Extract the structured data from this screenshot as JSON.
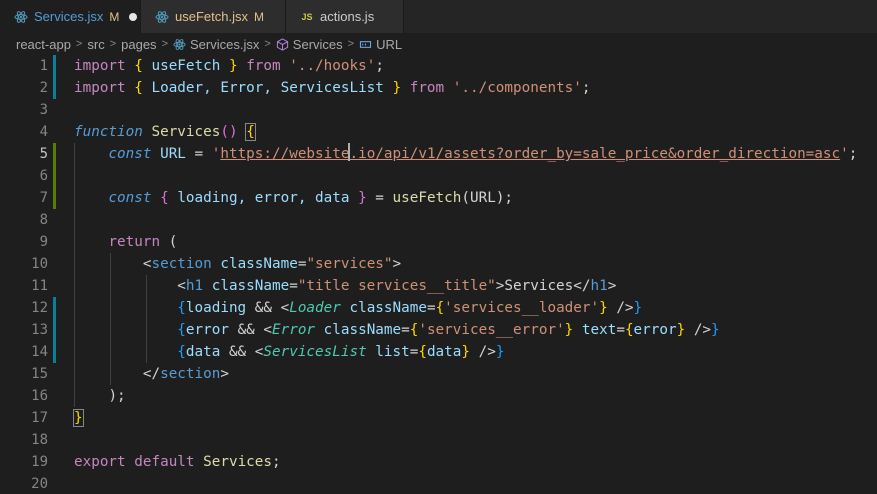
{
  "tabs": [
    {
      "name": "Services.jsx",
      "status": "M",
      "modified_dot": true,
      "icon": "react-icon",
      "active": true,
      "name_color": "#569cd6",
      "status_color": "#e2c08d"
    },
    {
      "name": "useFetch.jsx",
      "status": "M",
      "modified_dot": false,
      "icon": "react-icon",
      "active": false,
      "name_color": "#e2c08d",
      "status_color": "#e2c08d"
    },
    {
      "name": "actions.js",
      "status": "",
      "modified_dot": false,
      "icon": "js-icon",
      "active": false,
      "name_color": "#cccccc",
      "status_color": ""
    }
  ],
  "js_badge": "JS",
  "breadcrumb": {
    "items": [
      "react-app",
      "src",
      "pages",
      "Services.jsx",
      "Services",
      "URL"
    ],
    "separator": ">"
  },
  "gutter": [
    "1",
    "2",
    "3",
    "4",
    "5",
    "6",
    "7",
    "8",
    "9",
    "10",
    "11",
    "12",
    "13",
    "14",
    "15",
    "16",
    "17",
    "18",
    "19",
    "20"
  ],
  "code": {
    "l1": {
      "import": "import",
      "open": "{",
      "name": "useFetch",
      "close": "}",
      "from": "from",
      "path": "'../hooks'",
      "semi": ";"
    },
    "l2": {
      "import": "import",
      "open": "{",
      "names": "Loader, Error, ServicesList",
      "close": "}",
      "from": "from",
      "path": "'../components'",
      "semi": ";"
    },
    "l4": {
      "function": "function",
      "name": "Services",
      "parens": "()",
      "brace": "{"
    },
    "l5": {
      "const": "const",
      "name": "URL",
      "eq": "=",
      "quote_open": "'",
      "url_a": "https://website",
      "url_b": ".io/api/v1/assets?order_by=sale_price&order_direction=asc",
      "quote_close": "'",
      "semi": ";"
    },
    "l7": {
      "const": "const",
      "open": "{",
      "names": "loading, error, data",
      "close": "}",
      "eq": "=",
      "fn": "useFetch",
      "args": "(URL);"
    },
    "l9": {
      "return": "return",
      "paren": "("
    },
    "l10": {
      "lt": "<",
      "tag": "section",
      "attr": "className",
      "eq": "=",
      "val": "\"services\"",
      "gt": ">"
    },
    "l11": {
      "lt": "<",
      "tag": "h1",
      "attr": "className",
      "eq": "=",
      "val": "\"title services__title\"",
      "gt": ">",
      "text": "Services",
      "close_lt": "</",
      "close_tag": "h1",
      "close_gt": ">"
    },
    "l12": {
      "ob": "{",
      "cond": "loading",
      "and": "&&",
      "lt": "<",
      "comp": "Loader",
      "attr": "className",
      "eq": "=",
      "ib": "{",
      "val": "'services__loader'",
      "ie": "}",
      "selfclose": "/>",
      "cb": "}"
    },
    "l13": {
      "ob": "{",
      "cond": "error",
      "and": "&&",
      "lt": "<",
      "comp": "Error",
      "attr": "className",
      "eq": "=",
      "ib": "{",
      "val": "'services__error'",
      "ie": "}",
      "attr2": "text",
      "eq2": "=",
      "ib2": "{",
      "val2": "error",
      "ie2": "}",
      "selfclose": "/>",
      "cb": "}"
    },
    "l14": {
      "ob": "{",
      "cond": "data",
      "and": "&&",
      "lt": "<",
      "comp": "ServicesList",
      "attr": "list",
      "eq": "=",
      "ib": "{",
      "val": "data",
      "ie": "}",
      "selfclose": "/>",
      "cb": "}"
    },
    "l15": {
      "lt": "</",
      "tag": "section",
      "gt": ">"
    },
    "l16": {
      "text": ");"
    },
    "l17": {
      "brace": "}"
    },
    "l19": {
      "export": "export",
      "default": "default",
      "name": "Services",
      "semi": ";"
    }
  },
  "colors": {
    "background": "#1e1e1e",
    "git_added": "#587c0c",
    "git_modified": "#0c7d9d",
    "line_number": "#858585",
    "active_line_number": "#c6c6c6"
  }
}
